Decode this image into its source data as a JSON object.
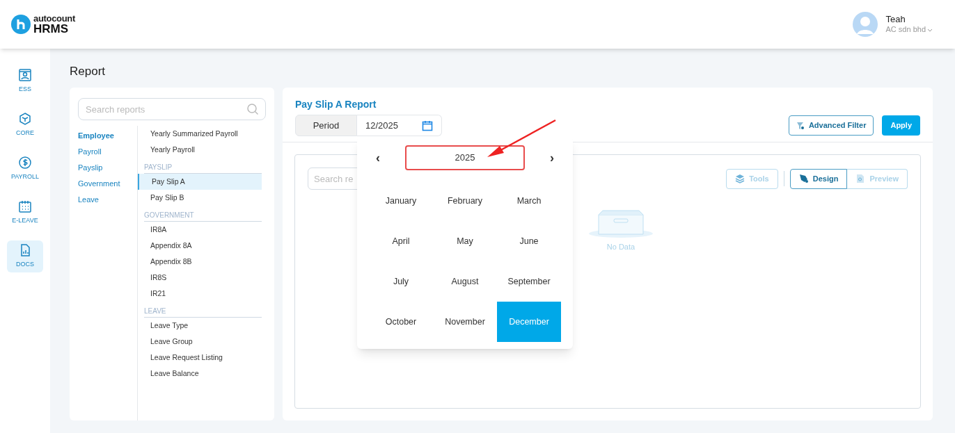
{
  "header": {
    "logo_top": "autocount",
    "logo_bottom": "HRMS",
    "user": {
      "name": "Teah",
      "company": "AC sdn bhd"
    }
  },
  "nav": [
    {
      "label": "ESS",
      "kind": "ess",
      "selected": false
    },
    {
      "label": "CORE",
      "kind": "core",
      "selected": false
    },
    {
      "label": "PAYROLL",
      "kind": "payroll",
      "selected": false
    },
    {
      "label": "E-LEAVE",
      "kind": "leave",
      "selected": false
    },
    {
      "label": "DOCS",
      "kind": "docs",
      "selected": true
    }
  ],
  "page_title": "Report",
  "report_search": {
    "placeholder": "Search reports"
  },
  "categories": [
    {
      "label": "Employee",
      "selected": true
    },
    {
      "label": "Payroll",
      "selected": false
    },
    {
      "label": "Payslip",
      "selected": false
    },
    {
      "label": "Government",
      "selected": false
    },
    {
      "label": "Leave",
      "selected": false
    }
  ],
  "report_groups": [
    {
      "items": [
        {
          "label": "Yearly Summarized Payroll",
          "selected": false
        },
        {
          "label": "Yearly Payroll",
          "selected": false
        }
      ]
    },
    {
      "heading": "PAYSLIP",
      "items": [
        {
          "label": "Pay Slip A",
          "selected": true
        },
        {
          "label": "Pay Slip B",
          "selected": false
        }
      ]
    },
    {
      "heading": "GOVERNMENT",
      "items": [
        {
          "label": "IR8A",
          "selected": false
        },
        {
          "label": "Appendix 8A",
          "selected": false
        },
        {
          "label": "Appendix 8B",
          "selected": false
        },
        {
          "label": "IR8S",
          "selected": false
        },
        {
          "label": "IR21",
          "selected": false
        }
      ]
    },
    {
      "heading": "LEAVE",
      "items": [
        {
          "label": "Leave Type",
          "selected": false
        },
        {
          "label": "Leave Group",
          "selected": false
        },
        {
          "label": "Leave Request Listing",
          "selected": false
        },
        {
          "label": "Leave Balance",
          "selected": false
        }
      ]
    }
  ],
  "report": {
    "title": "Pay Slip A Report",
    "period_label": "Period",
    "period_value": "12/2025",
    "advanced_filter": "Advanced Filter",
    "apply": "Apply"
  },
  "viewer": {
    "search_placeholder": "Search re",
    "tools": [
      {
        "label": "Tools",
        "kind": "tools",
        "selected": false
      },
      {
        "label": "Design",
        "kind": "design",
        "selected": true
      },
      {
        "label": "Preview",
        "kind": "preview",
        "selected": false
      }
    ],
    "empty_text": "No Data"
  },
  "picker": {
    "prev": "‹",
    "year": "2025",
    "next": "›",
    "months": [
      {
        "label": "January",
        "selected": false
      },
      {
        "label": "February",
        "selected": false
      },
      {
        "label": "March",
        "selected": false
      },
      {
        "label": "April",
        "selected": false
      },
      {
        "label": "May",
        "selected": false
      },
      {
        "label": "June",
        "selected": false
      },
      {
        "label": "July",
        "selected": false
      },
      {
        "label": "August",
        "selected": false
      },
      {
        "label": "September",
        "selected": false
      },
      {
        "label": "October",
        "selected": false
      },
      {
        "label": "November",
        "selected": false
      },
      {
        "label": "December",
        "selected": true
      }
    ]
  }
}
